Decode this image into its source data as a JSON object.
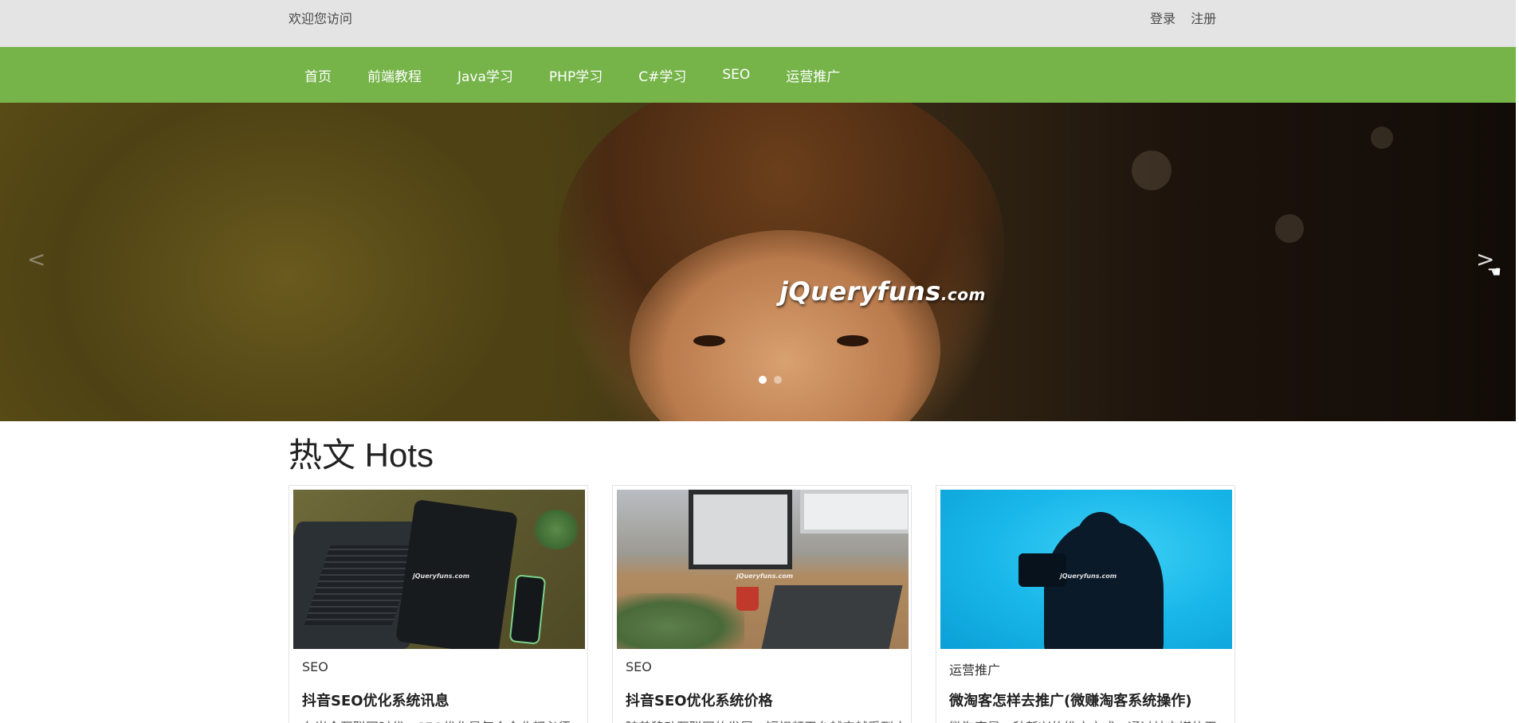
{
  "topbar": {
    "welcome": "欢迎您访问",
    "login": "登录",
    "register": "注册"
  },
  "nav": {
    "items": [
      "首页",
      "前端教程",
      "Java学习",
      "PHP学习",
      "C#学习",
      "SEO",
      "运营推广"
    ]
  },
  "hero": {
    "watermark_main": "jQueryfuns",
    "watermark_suffix": ".com",
    "prev_label": "<",
    "next_label": ">",
    "slide_count": 2,
    "active_slide": 1
  },
  "hots": {
    "title": "热文 Hots",
    "cards": [
      {
        "category": "SEO",
        "title": "抖音SEO优化系统讯息",
        "excerpt": "在当今互联网时代，SEO优化是每个企业都必须",
        "thumb_watermark": "jQueryfuns.com"
      },
      {
        "category": "SEO",
        "title": "抖音SEO优化系统价格",
        "excerpt": "随着移动互联网的发展，短视频平台越来越受到广",
        "thumb_watermark": "jQueryfuns.com"
      },
      {
        "category": "运营推广",
        "title": "微淘客怎样去推广(微赚淘客系统操作)",
        "excerpt": "微淘客是一种新兴的推广方式，通过社交媒体平",
        "thumb_watermark": "jQueryfuns.com"
      }
    ]
  },
  "colors": {
    "topbar_bg": "#e4e4e4",
    "nav_bg": "#76b44a",
    "nav_text": "#ffffff"
  }
}
